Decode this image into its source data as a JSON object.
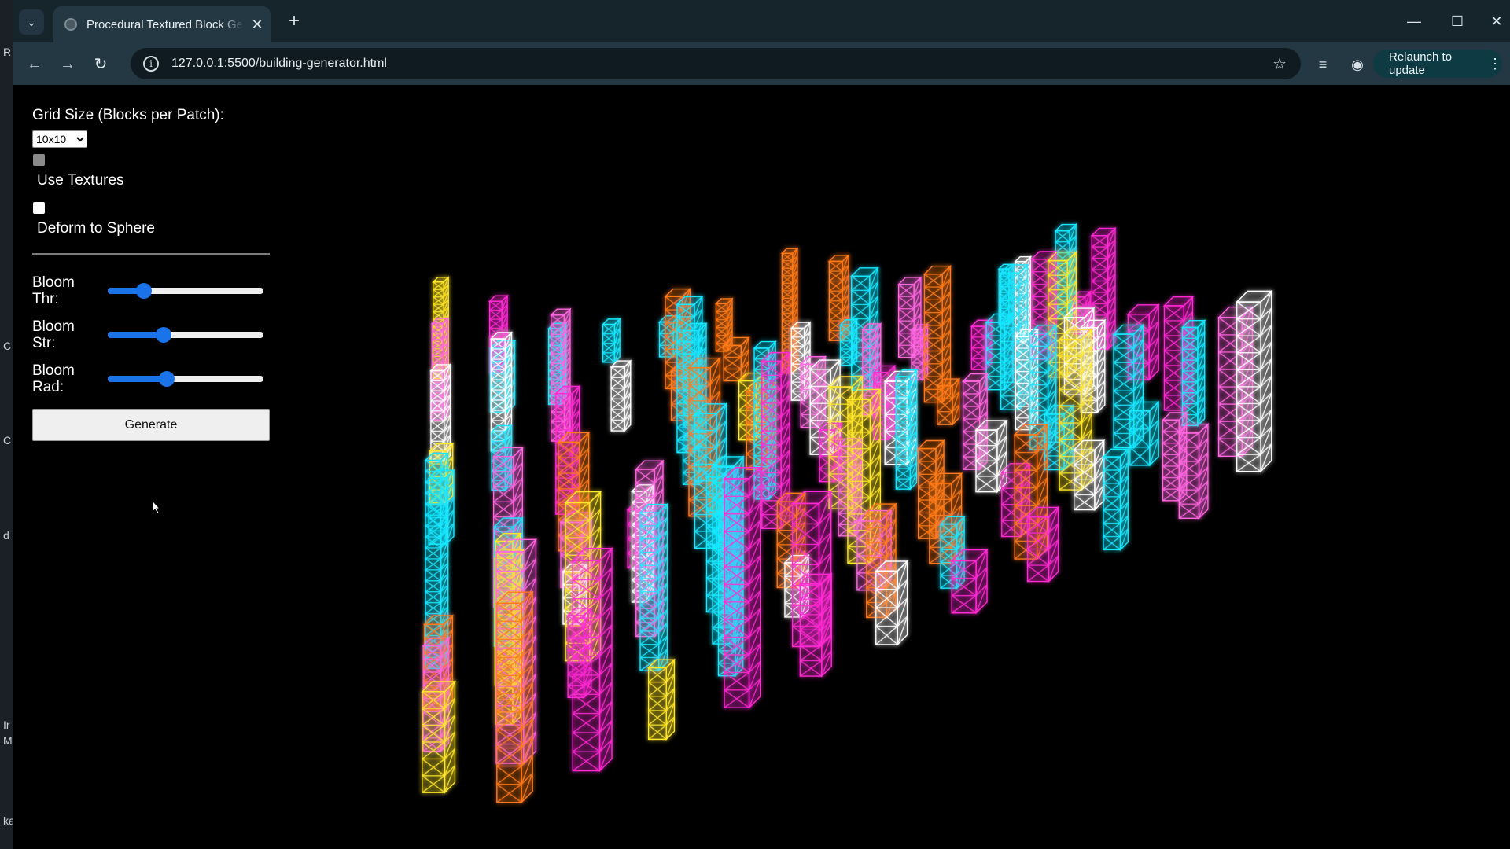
{
  "browser": {
    "tab_title": "Procedural Textured Block Generator",
    "url": "127.0.0.1:5500/building-generator.html",
    "relaunch_label": "Relaunch to update"
  },
  "controls": {
    "grid_size_label": "Grid Size (Blocks per Patch):",
    "grid_size_value": "10x10",
    "use_textures_label": "Use Textures",
    "use_textures_checked": false,
    "deform_label": "Deform to Sphere",
    "deform_checked": false,
    "sliders": [
      {
        "label_line1": "Bloom",
        "label_line2": "Thr:",
        "value_fraction": 0.23
      },
      {
        "label_line1": "Bloom",
        "label_line2": "Str:",
        "value_fraction": 0.36
      },
      {
        "label_line1": "Bloom",
        "label_line2": "Rad:",
        "value_fraction": 0.38
      }
    ],
    "generate_label": "Generate"
  },
  "scene": {
    "palette": [
      "#ff2ad4",
      "#ffe629",
      "#19e8ff",
      "#ff7a1a",
      "#ffffff",
      "#ff66e0"
    ]
  },
  "background_window_letters": [
    "R",
    "C",
    "C",
    "d",
    "Ir",
    "M",
    "ka"
  ]
}
